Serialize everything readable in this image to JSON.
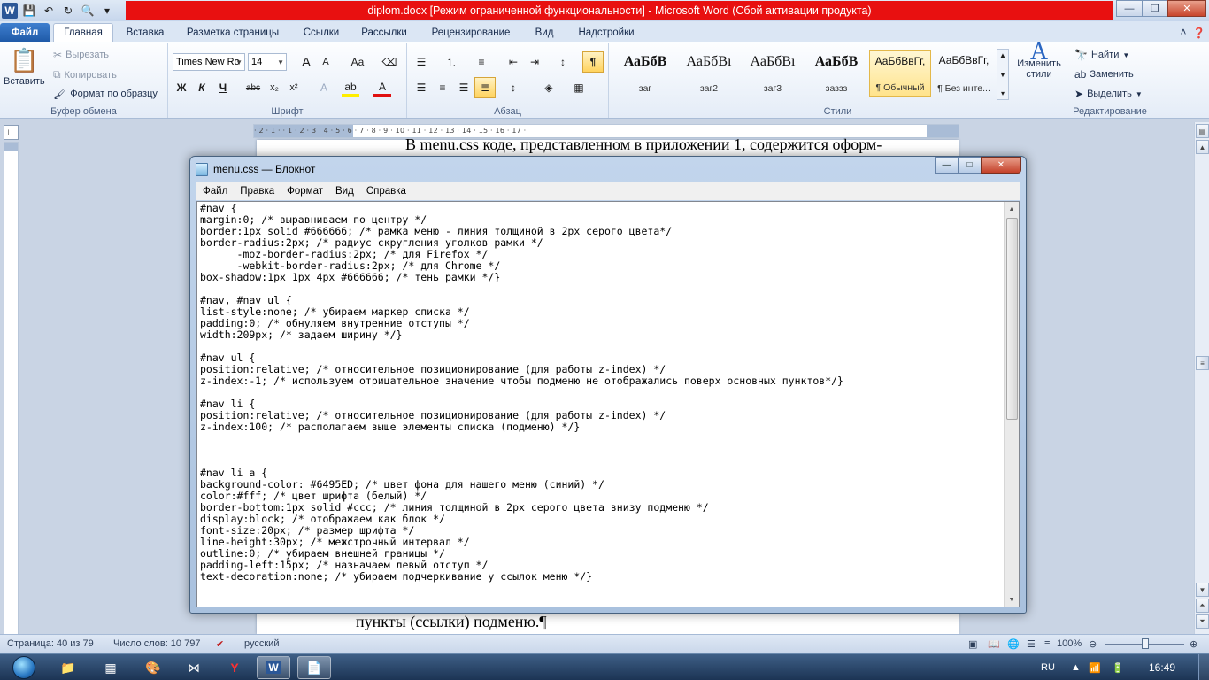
{
  "word": {
    "title": "diplom.docx [Режим ограниченной функциональности]  -  Microsoft Word (Сбой активации продукта)",
    "app_letter": "W",
    "tabs": [
      "Файл",
      "Главная",
      "Вставка",
      "Разметка страницы",
      "Ссылки",
      "Рассылки",
      "Рецензирование",
      "Вид",
      "Надстройки"
    ],
    "clipboard": {
      "paste": "Вставить",
      "cut": "Вырезать",
      "copy": "Копировать",
      "format_painter": "Формат по образцу",
      "label": "Буфер обмена"
    },
    "font": {
      "name": "Times New Ro",
      "size": "14",
      "label": "Шрифт",
      "bold": "Ж",
      "italic": "К",
      "underline": "Ч",
      "strike": "abc",
      "sub": "x₂",
      "sup": "x²",
      "grow": "A",
      "shrink": "A",
      "case": "Aa",
      "color": "A"
    },
    "paragraph": {
      "label": "Абзац",
      "pilcrow": "¶"
    },
    "styles": {
      "label": "Стили",
      "items": [
        {
          "sample": "АаБбВ",
          "name": "заг"
        },
        {
          "sample": "АаБбВı",
          "name": "заг2"
        },
        {
          "sample": "АаБбВı",
          "name": "заг3"
        },
        {
          "sample": "АаБбВ",
          "name": "заззз"
        },
        {
          "sample": "АаБбВвГг,",
          "name": "¶ Обычный"
        },
        {
          "sample": "АаБбВвГг,",
          "name": "¶ Без инте..."
        }
      ],
      "change": "Изменить стили"
    },
    "editing": {
      "find": "Найти",
      "replace": "Заменить",
      "select": "Выделить",
      "label": "Редактирование"
    },
    "doc_line_top": "В menu.css коде, представленном в приложении 1, содержится оформ-",
    "doc_line_bottom": "пункты (ссылки) подменю.¶",
    "status": {
      "page": "Страница: 40 из 79",
      "words": "Число слов: 10 797",
      "lang": "русский",
      "zoom": "100%"
    }
  },
  "notepad": {
    "title": "menu.css — Блокнот",
    "menu": [
      "Файл",
      "Правка",
      "Формат",
      "Вид",
      "Справка"
    ],
    "content": "#nav {\nmargin:0; /* выравниваем по центру */\nborder:1px solid #666666; /* рамка меню - линия толщиной в 2px серого цвета*/\nborder-radius:2px; /* радиус скругления уголков рамки */\n      -moz-border-radius:2px; /* для Firefox */\n      -webkit-border-radius:2px; /* для Chrome */\nbox-shadow:1px 1px 4px #666666; /* тень рамки */}\n\n#nav, #nav ul {\nlist-style:none; /* убираем маркер списка */\npadding:0; /* обнуляем внутренние отступы */\nwidth:209px; /* задаем ширину */}\n\n#nav ul {\nposition:relative; /* относительное позиционирование (для работы z-index) */\nz-index:-1; /* используем отрицательное значение чтобы подменю не отображались поверх основных пунктов*/}\n\n#nav li {\nposition:relative; /* относительное позиционирование (для работы z-index) */\nz-index:100; /* располагаем выше элементы списка (подменю) */}\n\n\n\n#nav li a {\nbackground-color: #6495ED; /* цвет фона для нашего меню (синий) */\ncolor:#fff; /* цвет шрифта (белый) */\nborder-bottom:1px solid #ccc; /* линия толщиной в 2px серого цвета внизу подменю */\ndisplay:block; /* отображаем как блок */\nfont-size:20px; /* размер шрифта */\nline-height:30px; /* межстрочный интервал */\noutline:0; /* убираем внешней границы */\npadding-left:15px; /* назначаем левый отступ */\ntext-decoration:none; /* убираем подчеркивание у ссылок меню */}"
  },
  "taskbar": {
    "lang": "RU",
    "time": "16:49"
  },
  "colors": {
    "title_red": "#e81010",
    "file_tab": "#2b5797",
    "taskbar": "#1c3454"
  }
}
